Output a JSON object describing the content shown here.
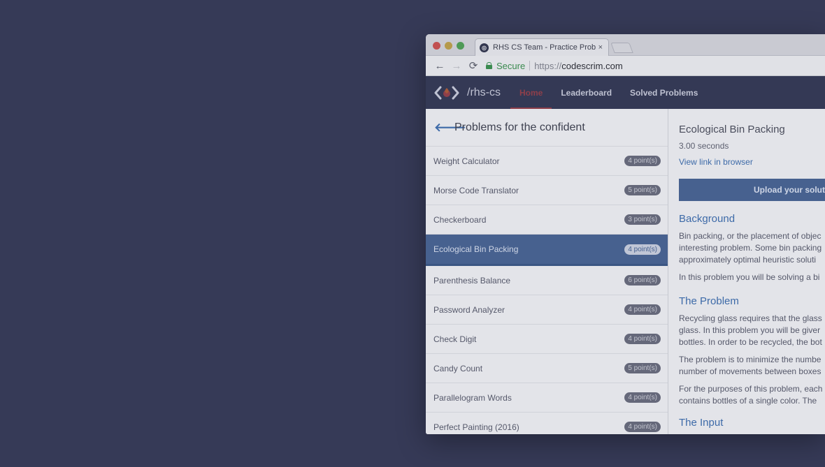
{
  "browser": {
    "tab_title": "RHS CS Team - Practice Probl",
    "tab_close": "×",
    "secure_label": "Secure",
    "url_scheme": "https://",
    "url_host": "codescrim.com"
  },
  "app": {
    "brand": "/rhs-cs",
    "nav": [
      {
        "label": "Home",
        "active": true
      },
      {
        "label": "Leaderboard",
        "active": false
      },
      {
        "label": "Solved Problems",
        "active": false
      }
    ]
  },
  "left": {
    "title": "Problems for the confident",
    "problems": [
      {
        "name": "Weight Calculator",
        "points": "4 point(s)"
      },
      {
        "name": "Morse Code Translator",
        "points": "5 point(s)"
      },
      {
        "name": "Checkerboard",
        "points": "3 point(s)"
      },
      {
        "name": "Ecological Bin Packing",
        "points": "4 point(s)",
        "selected": true
      },
      {
        "name": "Parenthesis Balance",
        "points": "6 point(s)"
      },
      {
        "name": "Password Analyzer",
        "points": "4 point(s)"
      },
      {
        "name": "Check Digit",
        "points": "4 point(s)"
      },
      {
        "name": "Candy Count",
        "points": "5 point(s)"
      },
      {
        "name": "Parallelogram Words",
        "points": "4 point(s)"
      },
      {
        "name": "Perfect Painting (2016)",
        "points": "4 point(s)"
      }
    ]
  },
  "detail": {
    "title": "Ecological Bin Packing",
    "time": "3.00 seconds",
    "link": "View link in browser",
    "upload": "Upload your soluti",
    "background_h": "Background",
    "bg_lines": [
      "Bin packing, or the placement of objec",
      "interesting problem. Some bin packing",
      "approximately optimal heuristic soluti"
    ],
    "bg_para2": "In this problem you will be solving a bi",
    "problem_h": "The Problem",
    "prob_lines": [
      "Recycling glass requires that the glass",
      "glass. In this problem you will be giver",
      "bottles. In order to be recycled, the bot"
    ],
    "prob_para2_lines": [
      "The problem is to minimize the numbe",
      "number of movements between boxes"
    ],
    "prob_para3_lines": [
      "For the purposes of this problem, each",
      "contains bottles of a single color. The"
    ],
    "input_h": "The Input"
  },
  "colors": {
    "backdrop": "#363a57",
    "appbar": "#343955",
    "accent_red": "#8f3f4a",
    "accent_blue": "#3d6aa8",
    "selected_row": "#47618f"
  }
}
